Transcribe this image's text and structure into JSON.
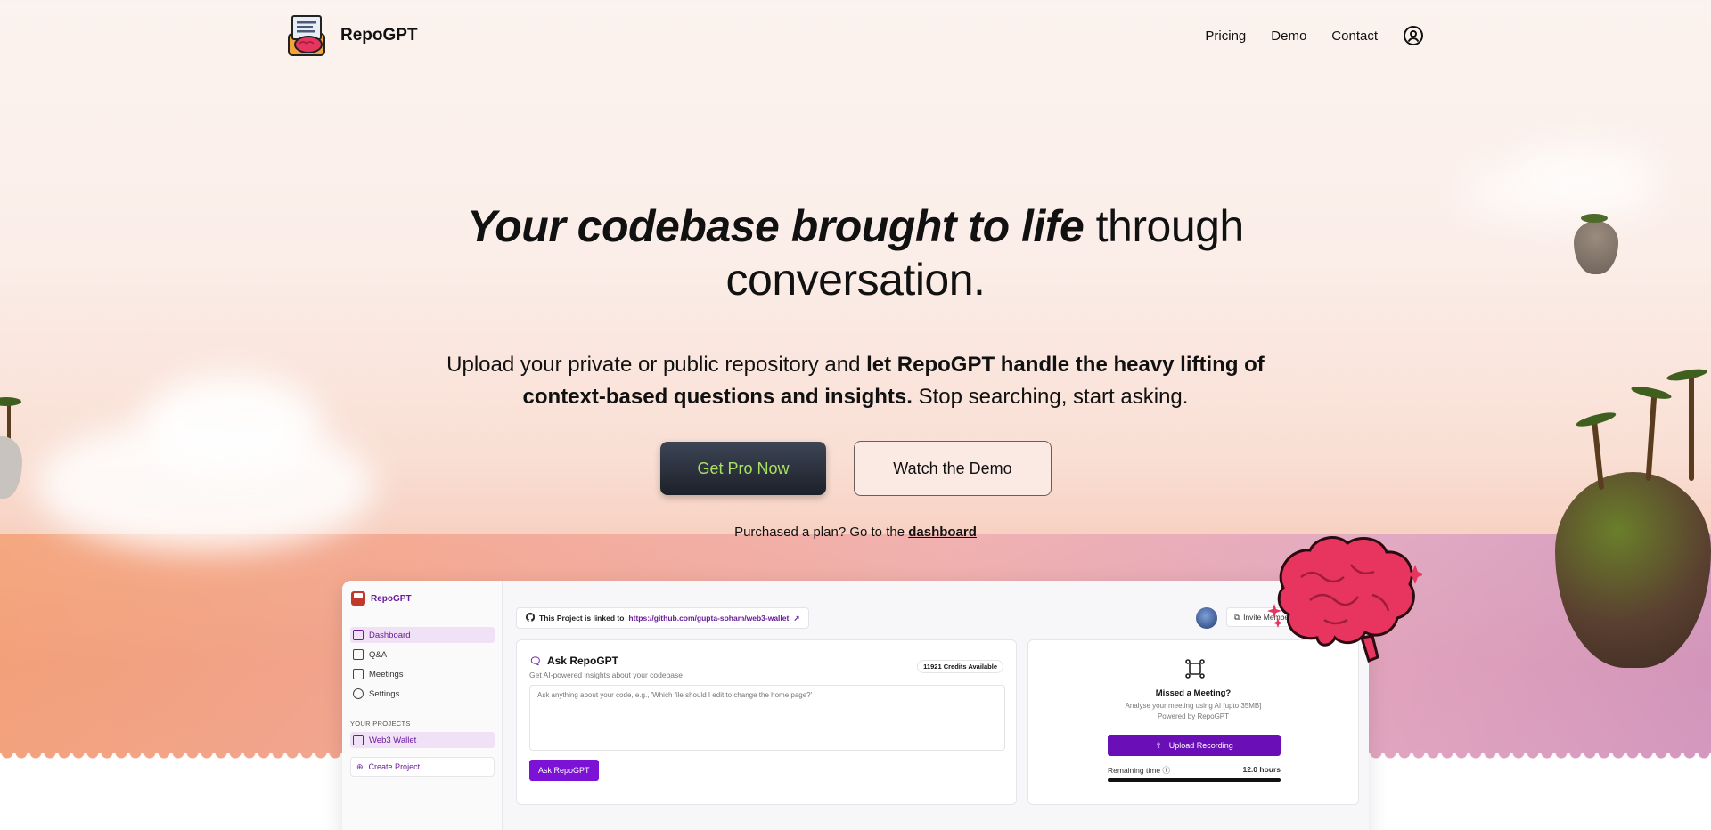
{
  "header": {
    "brand": "RepoGPT",
    "nav": [
      "Pricing",
      "Demo",
      "Contact"
    ]
  },
  "hero": {
    "headline_emphasis": "Your codebase brought to life",
    "headline_line1_rest": " through",
    "headline_line2": "conversation.",
    "sub_part1": "Upload your private or public repository and ",
    "sub_bold": "let RepoGPT handle the heavy lifting of context-based questions and insights.",
    "sub_part2": " Stop searching, start asking.",
    "primary_cta": "Get Pro Now",
    "secondary_cta": "Watch the Demo",
    "purchased_text": "Purchased a plan? Go to the ",
    "purchased_link": "dashboard"
  },
  "app_preview": {
    "brand": "RepoGPT",
    "sidebar": {
      "items": [
        "Dashboard",
        "Q&A",
        "Meetings",
        "Settings"
      ],
      "active": "Dashboard",
      "projects_heading": "YOUR PROJECTS",
      "projects": [
        "Web3 Wallet"
      ],
      "create_project": "Create Project"
    },
    "linked_prefix": "This Project is linked to",
    "linked_url": "https://github.com/gupta-soham/web3-wallet",
    "invite_label": "Invite Members",
    "ask": {
      "title": "Ask RepoGPT",
      "subtitle": "Get AI-powered insights about your codebase",
      "credits": "11921 Credits Available",
      "placeholder": "Ask anything about your code, e.g., 'Which file should I edit to change the home page?'",
      "button": "Ask RepoGPT"
    },
    "meeting": {
      "title": "Missed a Meeting?",
      "line1": "Analyse your meeting using AI [upto 35MB]",
      "line2": "Powered by RepoGPT",
      "upload": "Upload Recording",
      "remaining_label": "Remaining time",
      "remaining_value": "12.0 hours",
      "remaining_fraction": 1.0
    }
  },
  "colors": {
    "accent_purple": "#7b12d6",
    "cta_text": "#a8e15f",
    "brain": "#e8355f"
  }
}
